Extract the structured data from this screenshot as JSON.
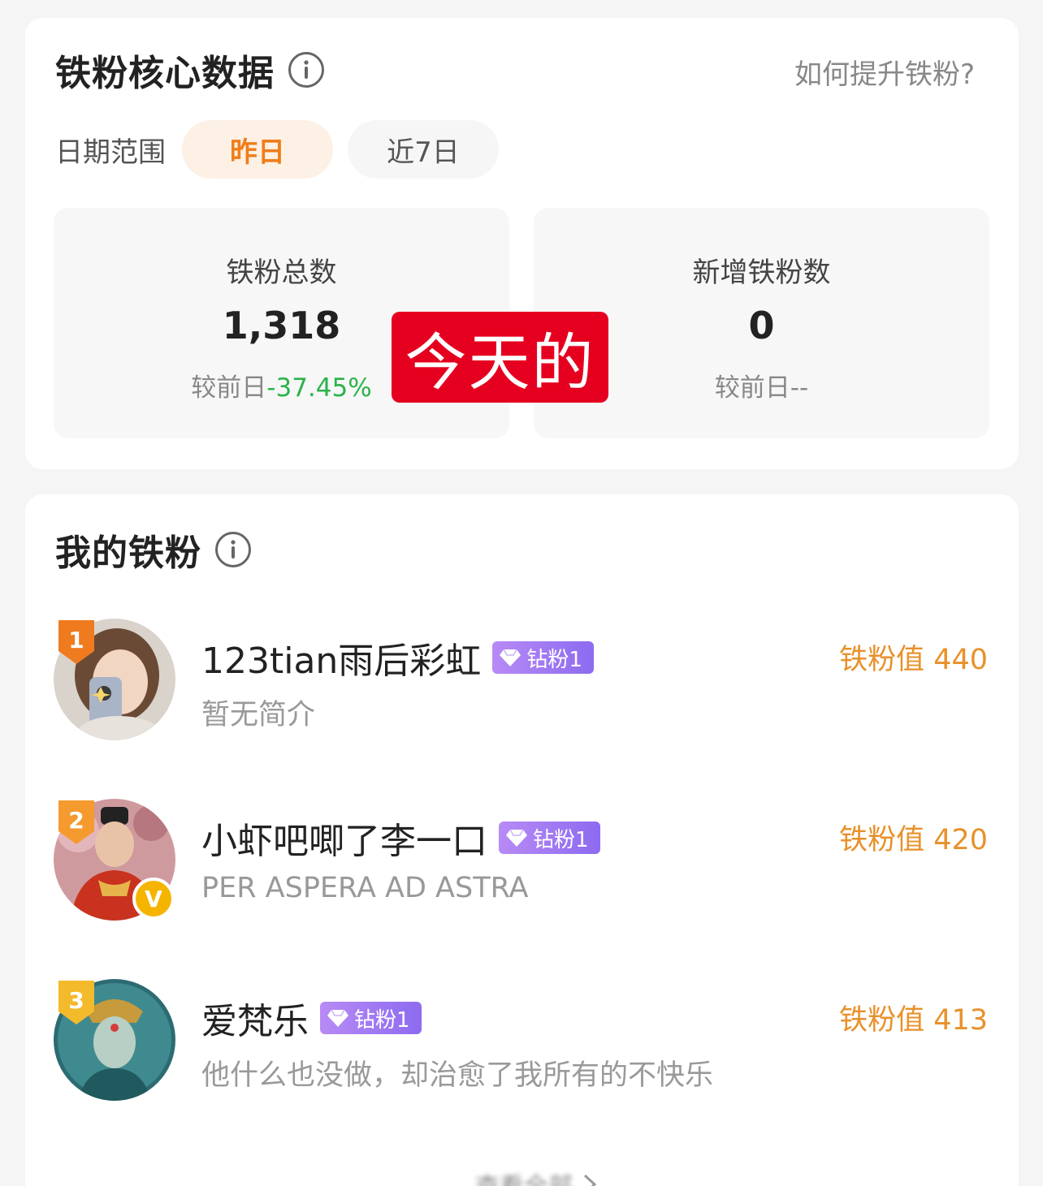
{
  "core": {
    "title": "铁粉核心数据",
    "help_link": "如何提升铁粉?",
    "date_range_label": "日期范围",
    "tabs": [
      {
        "label": "昨日",
        "active": true
      },
      {
        "label": "近7日",
        "active": false
      }
    ],
    "stats": [
      {
        "label": "铁粉总数",
        "value": "1,318",
        "compare_prefix": "较前日",
        "compare_value": "-37.45%"
      },
      {
        "label": "新增铁粉数",
        "value": "0",
        "compare_prefix": "较前日",
        "compare_value": "--"
      }
    ],
    "overlay_tag": "今天的"
  },
  "fans": {
    "title": "我的铁粉",
    "list": [
      {
        "rank": "1",
        "name": "123tian雨后彩虹",
        "badge": "钻粉1",
        "bio": "暂无简介",
        "score": "铁粉值 440",
        "verified": false
      },
      {
        "rank": "2",
        "name": "小虾吧唧了李一口",
        "badge": "钻粉1",
        "bio": "PER ASPERA AD ASTRA",
        "score": "铁粉值 420",
        "verified": true
      },
      {
        "rank": "3",
        "name": "爱梵乐",
        "badge": "钻粉1",
        "bio": "他什么也没做，却治愈了我所有的不快乐",
        "score": "铁粉值 413",
        "verified": false
      }
    ],
    "more_label": "查看全部"
  },
  "colors": {
    "accent": "#f07d1a",
    "score": "#e8912a",
    "negative": "#2bb34a",
    "overlay": "#e5001f",
    "badge": "#9a72f2",
    "verified": "#f5b400"
  },
  "icons": [
    "info-icon",
    "diamond-icon",
    "chevron-right-icon",
    "rank-badge-icon",
    "verified-icon"
  ]
}
